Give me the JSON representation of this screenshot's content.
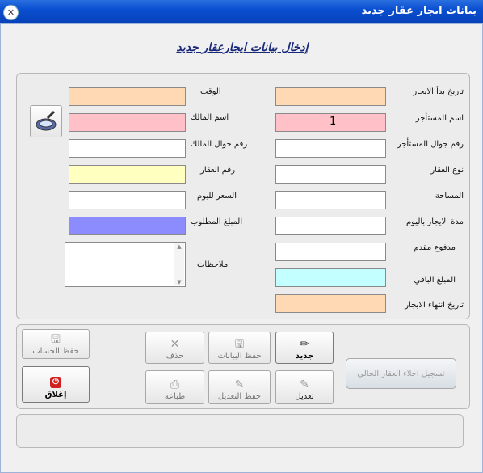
{
  "window": {
    "title": "بيانات  ايجار عقار جديد"
  },
  "heading": "إدخال بيانات ايجارعقار جديد",
  "colors": {
    "peach": "#ffd9b3",
    "pink": "#ffc0c8",
    "yellow": "#ffffc0",
    "blue": "#8c8cff",
    "cyan": "#c4ffff"
  },
  "right": {
    "start_date": "تاريخ بدأ الايجار",
    "tenant_name": "اسم المستأجر",
    "tenant_name_value": "1",
    "tenant_mobile": "رقم جوال المستأجر",
    "property_type": "نوع العقار",
    "area": "المساحة",
    "duration": "مدة الايجار باليوم",
    "advance": "مدفوع مقدم",
    "remaining": "المبلغ الباقي",
    "end_date": "تاريخ انتهاء الايجار"
  },
  "left": {
    "time": "الوقت",
    "owner_name": "اسم المالك",
    "owner_mobile": "رقم جوال المالك",
    "property_no": "رقم العقار",
    "daily_price": "السعر لليوم",
    "amount_due": "المبلغ المطلوب",
    "notes": "ملاحظات"
  },
  "buttons": {
    "new": "جديد",
    "save_data": "حفظ البيانات",
    "delete": "حذف",
    "save_account": "حفظ الحساب",
    "edit": "تعديل",
    "save_edit": "حفظ التعديل",
    "print": "طباعة",
    "close": "إغلاق",
    "vacate": "تسجيل اخلاء العقار الحالي"
  }
}
